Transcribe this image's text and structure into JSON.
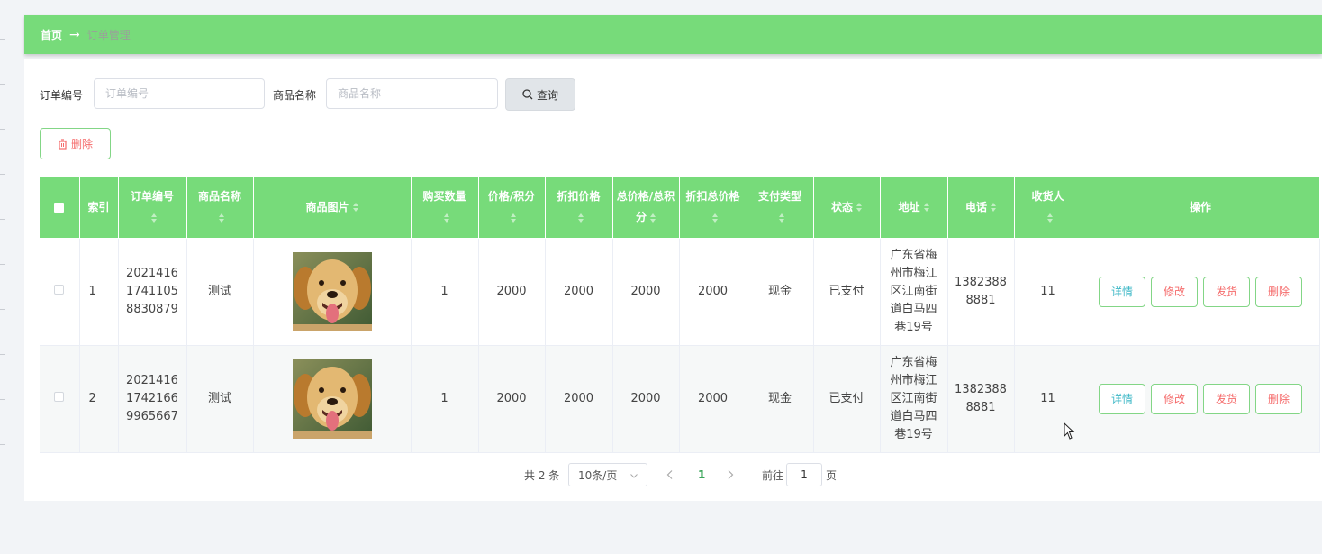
{
  "breadcrumb": {
    "home": "首页",
    "arrow": "→",
    "current": "订单管理"
  },
  "search": {
    "order_no_label": "订单编号",
    "order_no_placeholder": "订单编号",
    "order_no_value": "",
    "product_label": "商品名称",
    "product_placeholder": "商品名称",
    "product_value": "",
    "query_button": "查询"
  },
  "toolbar": {
    "delete_button": "删除"
  },
  "table": {
    "headers": {
      "index": "索引",
      "order_no": "订单编号",
      "product_name": "商品名称",
      "product_image": "商品图片",
      "quantity": "购买数量",
      "price_points": "价格/积分",
      "discount_price": "折扣价格",
      "total_price_points": "总价格/总积分",
      "discount_total": "折扣总价格",
      "payment_type": "支付类型",
      "status": "状态",
      "address": "地址",
      "phone": "电话",
      "receiver": "收货人",
      "actions": "操作"
    },
    "rows": [
      {
        "index": "1",
        "order_no": "20214161741105 8830879",
        "order_no_lines": [
          "2021416",
          "1741105",
          "8830879"
        ],
        "product_name": "测试",
        "quantity": "1",
        "price_points": "2000",
        "discount_price": "2000",
        "total_price_points": "2000",
        "discount_total": "2000",
        "payment_type": "现金",
        "status": "已支付",
        "address_lines": [
          "广东省梅",
          "州市梅江",
          "区江南街",
          "道白马四",
          "巷19号"
        ],
        "phone_lines": [
          "1382388",
          "8881"
        ],
        "receiver": "11"
      },
      {
        "index": "2",
        "order_no_lines": [
          "2021416",
          "1742166",
          "9965667"
        ],
        "product_name": "测试",
        "quantity": "1",
        "price_points": "2000",
        "discount_price": "2000",
        "total_price_points": "2000",
        "discount_total": "2000",
        "payment_type": "现金",
        "status": "已支付",
        "address_lines": [
          "广东省梅",
          "州市梅江",
          "区江南街",
          "道白马四",
          "巷19号"
        ],
        "phone_lines": [
          "1382388",
          "8881"
        ],
        "receiver": "11"
      }
    ],
    "row_actions": {
      "detail": "详情",
      "edit": "修改",
      "ship": "发货",
      "delete": "删除"
    }
  },
  "pagination": {
    "total": "共 2 条",
    "page_size": "10条/页",
    "current_page": "1",
    "goto_label": "前往",
    "goto_value": "1",
    "goto_suffix": "页"
  },
  "colors": {
    "accent": "#77db7a",
    "danger": "#f56c6c",
    "info": "#3bb7c6"
  }
}
